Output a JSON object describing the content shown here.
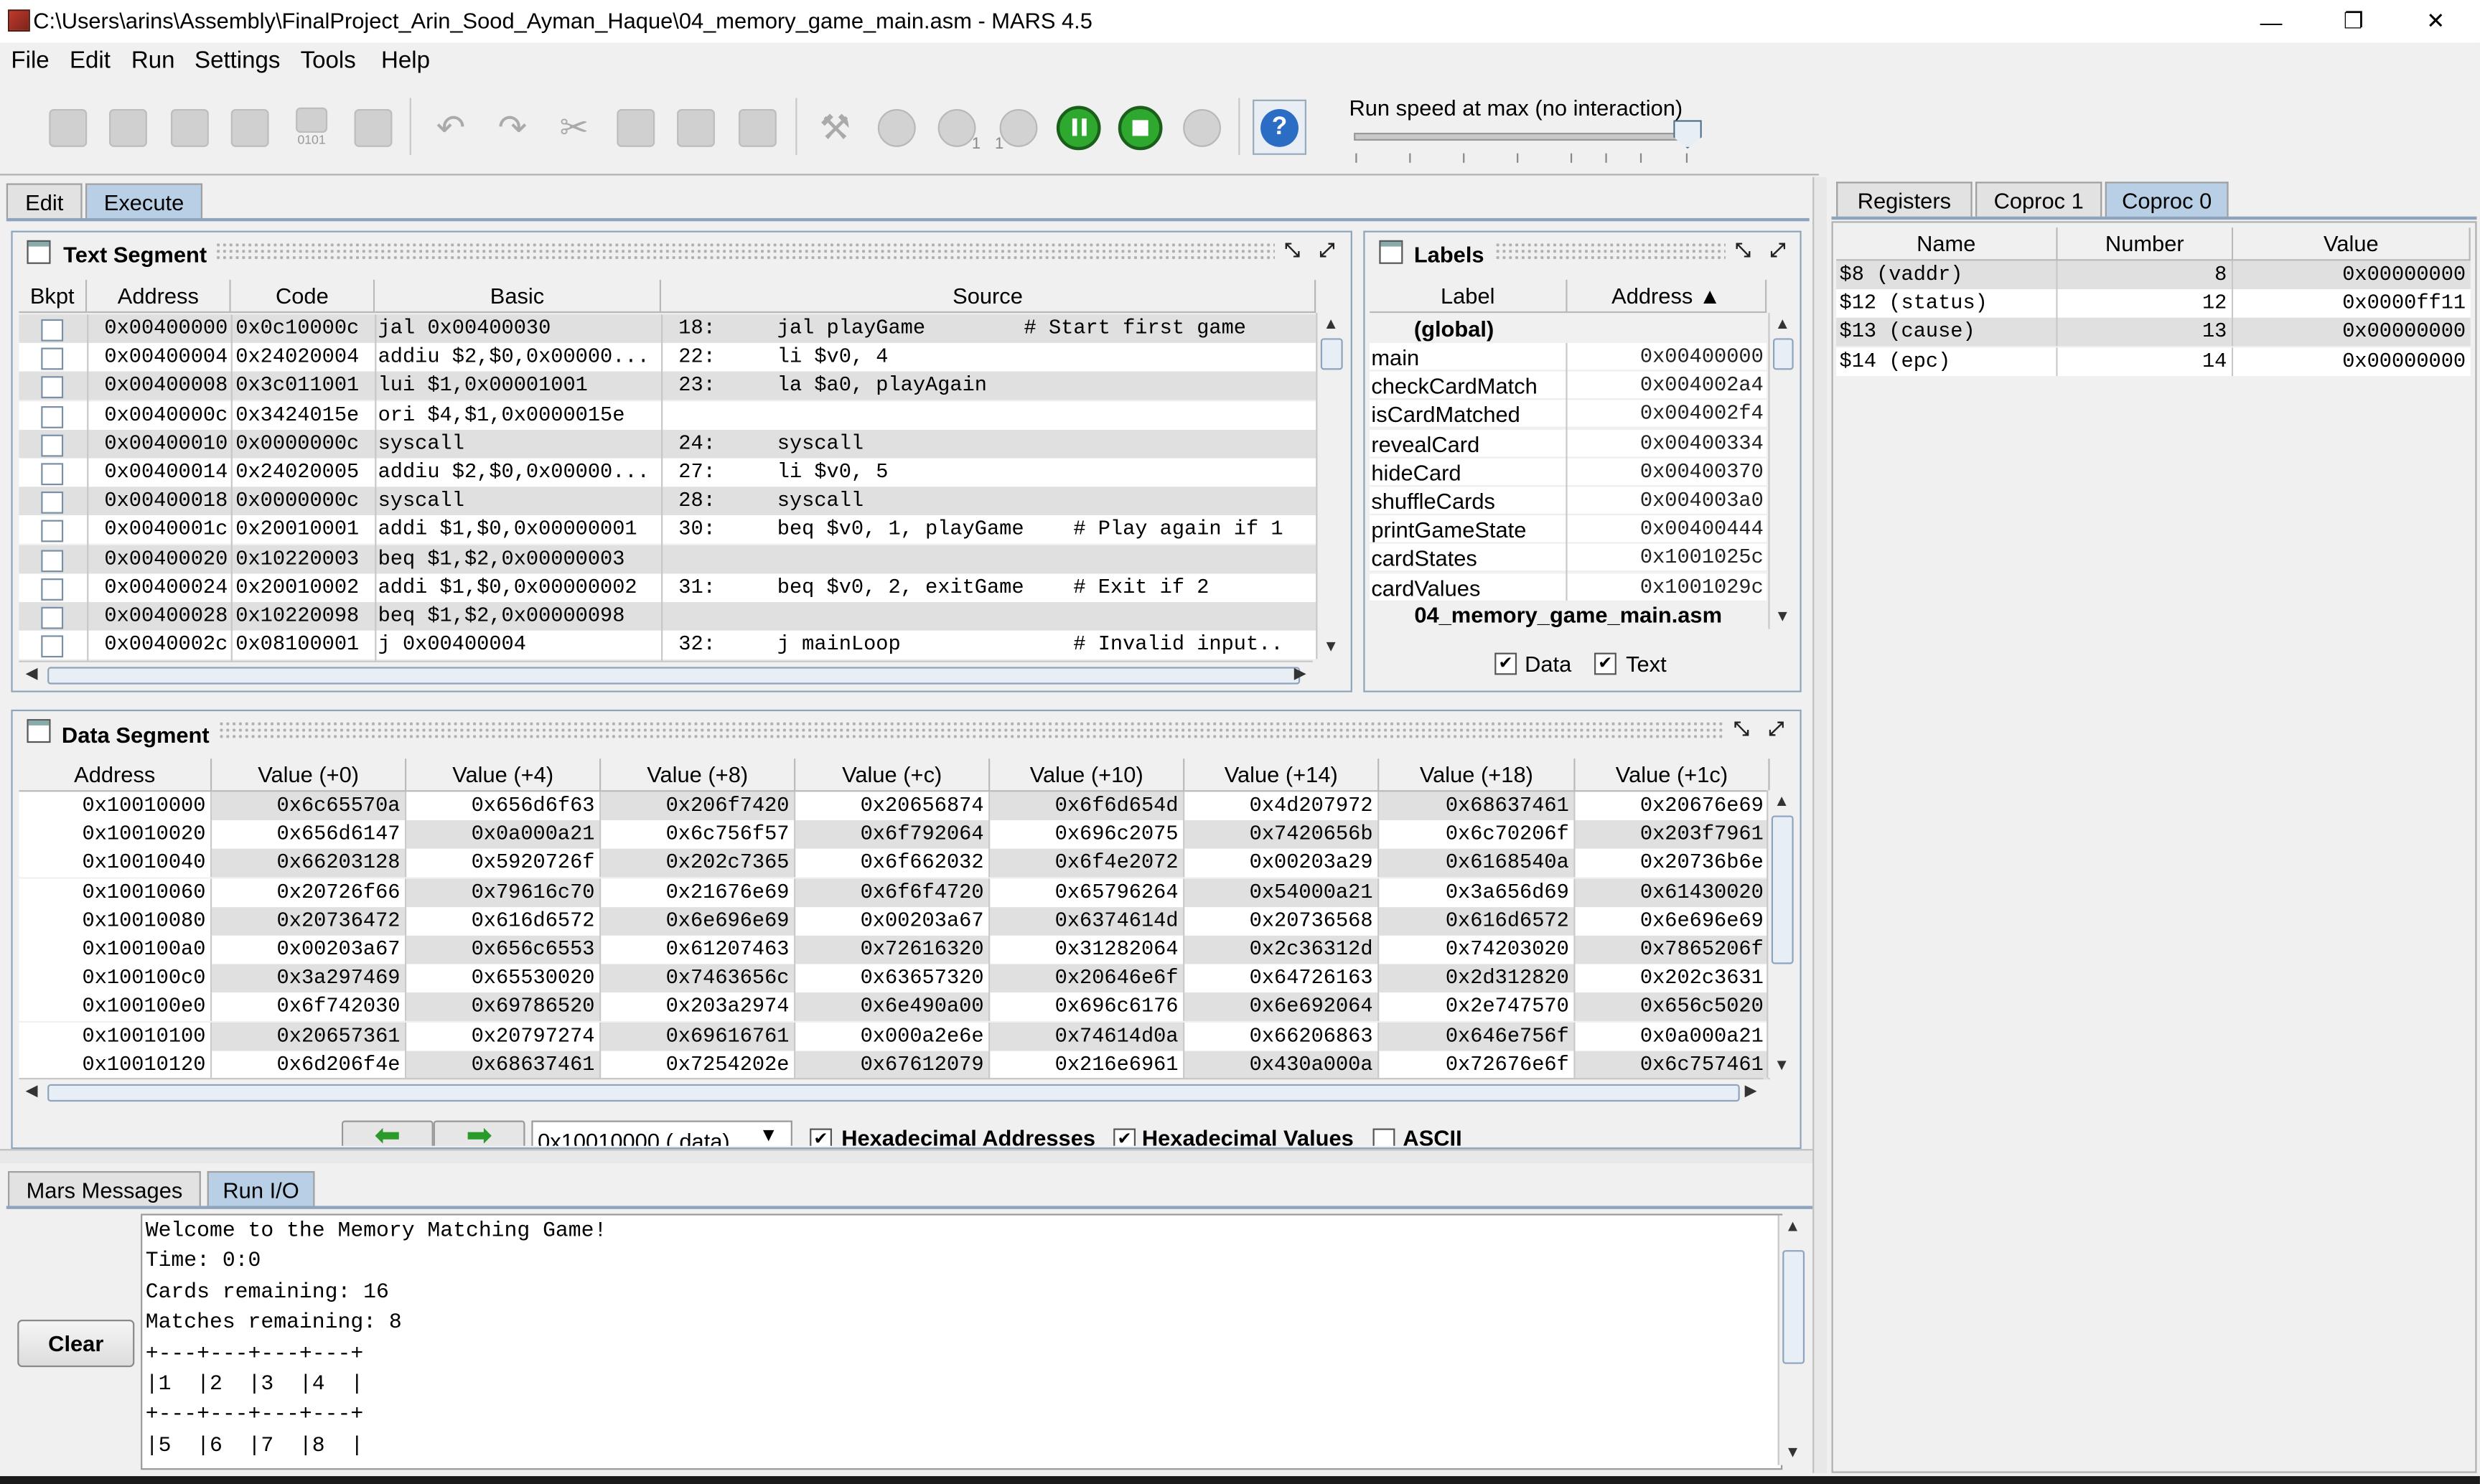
{
  "window": {
    "title": "C:\\Users\\arins\\Assembly\\FinalProject_Arin_Sood_Ayman_Haque\\04_memory_game_main.asm  - MARS 4.5",
    "minimize_glyph": "—",
    "restore_glyph": "❐",
    "close_glyph": "✕"
  },
  "menu": [
    {
      "label": "File"
    },
    {
      "label": "Edit"
    },
    {
      "label": "Run"
    },
    {
      "label": "Settings"
    },
    {
      "label": "Tools"
    },
    {
      "label": "Help"
    }
  ],
  "toolbar": {
    "icons": [
      "new-file-icon",
      "open-file-icon",
      "save-icon",
      "save-as-icon",
      "dump-memory-icon",
      "print-icon",
      "undo-icon",
      "redo-icon",
      "cut-icon",
      "copy-icon",
      "paste-icon",
      "find-replace-icon",
      "assemble-icon",
      "run-icon",
      "step-icon",
      "backstep-icon",
      "pause-icon",
      "stop-icon",
      "reset-icon",
      "help-icon"
    ],
    "dump_label": "0101",
    "step_sub": "1",
    "backstep_sub": "1",
    "help_glyph": "?",
    "speed_label": "Run speed at max (no interaction)",
    "speed_fraction": 1.0
  },
  "editor_tabs": [
    {
      "label": "Edit"
    },
    {
      "label": "Execute",
      "selected": true
    }
  ],
  "text_segment": {
    "title": "Text Segment",
    "columns": [
      "Bkpt",
      "Address",
      "Code",
      "Basic",
      "Source"
    ],
    "rows": [
      {
        "address": "0x00400000",
        "code": "0x0c10000c",
        "basic": "jal 0x00400030",
        "source": "18:     jal playGame        # Start first game"
      },
      {
        "address": "0x00400004",
        "code": "0x24020004",
        "basic": "addiu $2,$0,0x00000...",
        "source": "22:     li $v0, 4"
      },
      {
        "address": "0x00400008",
        "code": "0x3c011001",
        "basic": "lui $1,0x00001001",
        "source": "23:     la $a0, playAgain"
      },
      {
        "address": "0x0040000c",
        "code": "0x3424015e",
        "basic": "ori $4,$1,0x0000015e",
        "source": ""
      },
      {
        "address": "0x00400010",
        "code": "0x0000000c",
        "basic": "syscall",
        "source": "24:     syscall"
      },
      {
        "address": "0x00400014",
        "code": "0x24020005",
        "basic": "addiu $2,$0,0x00000...",
        "source": "27:     li $v0, 5"
      },
      {
        "address": "0x00400018",
        "code": "0x0000000c",
        "basic": "syscall",
        "source": "28:     syscall"
      },
      {
        "address": "0x0040001c",
        "code": "0x20010001",
        "basic": "addi $1,$0,0x00000001",
        "source": "30:     beq $v0, 1, playGame    # Play again if 1"
      },
      {
        "address": "0x00400020",
        "code": "0x10220003",
        "basic": "beq $1,$2,0x00000003",
        "source": ""
      },
      {
        "address": "0x00400024",
        "code": "0x20010002",
        "basic": "addi $1,$0,0x00000002",
        "source": "31:     beq $v0, 2, exitGame    # Exit if 2"
      },
      {
        "address": "0x00400028",
        "code": "0x10220098",
        "basic": "beq $1,$2,0x00000098",
        "source": ""
      },
      {
        "address": "0x0040002c",
        "code": "0x08100001",
        "basic": "j 0x00400004",
        "source": "32:     j mainLoop              # Invalid input.."
      }
    ]
  },
  "labels": {
    "title": "Labels",
    "columns": [
      "Label",
      "Address ▲"
    ],
    "group": "(global)",
    "rows": [
      {
        "label": "main",
        "address": "0x00400000"
      },
      {
        "label": "checkCardMatch",
        "address": "0x004002a4"
      },
      {
        "label": "isCardMatched",
        "address": "0x004002f4"
      },
      {
        "label": "revealCard",
        "address": "0x00400334"
      },
      {
        "label": "hideCard",
        "address": "0x00400370"
      },
      {
        "label": "shuffleCards",
        "address": "0x004003a0"
      },
      {
        "label": "printGameState",
        "address": "0x00400444"
      },
      {
        "label": "cardStates",
        "address": "0x1001025c"
      },
      {
        "label": "cardValues",
        "address": "0x1001029c"
      }
    ],
    "file": "04_memory_game_main.asm",
    "data_label": "Data",
    "text_label": "Text",
    "check_glyph": "✔"
  },
  "data_segment": {
    "title": "Data Segment",
    "columns": [
      "Address",
      "Value (+0)",
      "Value (+4)",
      "Value (+8)",
      "Value (+c)",
      "Value (+10)",
      "Value (+14)",
      "Value (+18)",
      "Value (+1c)"
    ],
    "rows": [
      [
        "0x10010000",
        "0x6c65570a",
        "0x656d6f63",
        "0x206f7420",
        "0x20656874",
        "0x6f6d654d",
        "0x4d207972",
        "0x68637461",
        "0x20676e69"
      ],
      [
        "0x10010020",
        "0x656d6147",
        "0x0a000a21",
        "0x6c756f57",
        "0x6f792064",
        "0x696c2075",
        "0x7420656b",
        "0x6c70206f",
        "0x203f7961"
      ],
      [
        "0x10010040",
        "0x66203128",
        "0x5920726f",
        "0x202c7365",
        "0x6f662032",
        "0x6f4e2072",
        "0x00203a29",
        "0x6168540a",
        "0x20736b6e"
      ],
      [
        "0x10010060",
        "0x20726f66",
        "0x79616c70",
        "0x21676e69",
        "0x6f6f4720",
        "0x65796264",
        "0x54000a21",
        "0x3a656d69",
        "0x61430020"
      ],
      [
        "0x10010080",
        "0x20736472",
        "0x616d6572",
        "0x6e696e69",
        "0x00203a67",
        "0x6374614d",
        "0x20736568",
        "0x616d6572",
        "0x6e696e69"
      ],
      [
        "0x100100a0",
        "0x00203a67",
        "0x656c6553",
        "0x61207463",
        "0x72616320",
        "0x31282064",
        "0x2c36312d",
        "0x74203020",
        "0x7865206f"
      ],
      [
        "0x100100c0",
        "0x3a297469",
        "0x65530020",
        "0x7463656c",
        "0x63657320",
        "0x20646e6f",
        "0x64726163",
        "0x2d312820",
        "0x202c3631"
      ],
      [
        "0x100100e0",
        "0x6f742030",
        "0x69786520",
        "0x203a2974",
        "0x6e490a00",
        "0x696c6176",
        "0x6e692064",
        "0x2e747570",
        "0x656c5020"
      ],
      [
        "0x10010100",
        "0x20657361",
        "0x20797274",
        "0x69616761",
        "0x000a2e6e",
        "0x74614d0a",
        "0x66206863",
        "0x646e756f",
        "0x0a000a21"
      ],
      [
        "0x10010120",
        "0x6d206f4e",
        "0x68637461",
        "0x7254202e",
        "0x67612079",
        "0x216e6961",
        "0x430a000a",
        "0x72676e6f",
        "0x6c757461"
      ]
    ],
    "segment_select": "0x10010000 (.data)",
    "hex_addresses_label": "Hexadecimal Addresses",
    "hex_values_label": "Hexadecimal Values",
    "ascii_label": "ASCII"
  },
  "messages": {
    "tabs": [
      {
        "label": "Mars Messages"
      },
      {
        "label": "Run I/O",
        "selected": true
      }
    ],
    "clear_label": "Clear",
    "lines": [
      "Welcome to the Memory Matching Game!",
      "Time: 0:0",
      "Cards remaining: 16",
      "Matches remaining: 8",
      "+---+---+---+---+",
      "|1  |2  |3  |4  |",
      "+---+---+---+---+",
      "|5  |6  |7  |8  |"
    ]
  },
  "registers": {
    "tabs": [
      {
        "label": "Registers"
      },
      {
        "label": "Coproc 1"
      },
      {
        "label": "Coproc 0",
        "selected": true
      }
    ],
    "columns": [
      "Name",
      "Number",
      "Value"
    ],
    "rows": [
      {
        "name": "$8 (vaddr)",
        "number": "8",
        "value": "0x00000000"
      },
      {
        "name": "$12 (status)",
        "number": "12",
        "value": "0x0000ff11"
      },
      {
        "name": "$13 (cause)",
        "number": "13",
        "value": "0x00000000"
      },
      {
        "name": "$14 (epc)",
        "number": "14",
        "value": "0x00000000"
      }
    ]
  },
  "colors": {
    "selected_tab": "#b8cfe5",
    "row_alt": "#e0e0e0",
    "green_button": "#22aa22",
    "help_blue": "#2b6cc4"
  }
}
